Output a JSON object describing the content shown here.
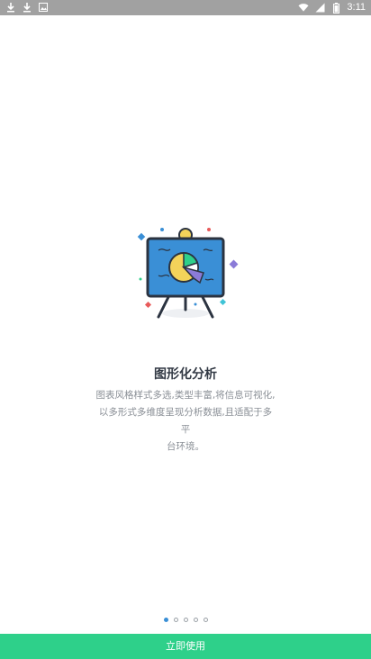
{
  "status_bar": {
    "left_icons": [
      "download-icon",
      "download-icon",
      "image-icon"
    ],
    "right_icons": [
      "wifi-icon",
      "signal-icon",
      "battery-icon"
    ],
    "time": "3:11"
  },
  "onboarding": {
    "illustration": "presentation-board-pie-chart-icon",
    "title": "图形化分析",
    "description_lines": [
      "图表风格样式多选,类型丰富,将信息可视化,",
      "以多形式多维度呈现分析数据,且适配于多平",
      "台环境。"
    ]
  },
  "pager": {
    "total": 5,
    "current": 1
  },
  "cta": {
    "label": "立即使用",
    "color": "#2ed08a"
  }
}
